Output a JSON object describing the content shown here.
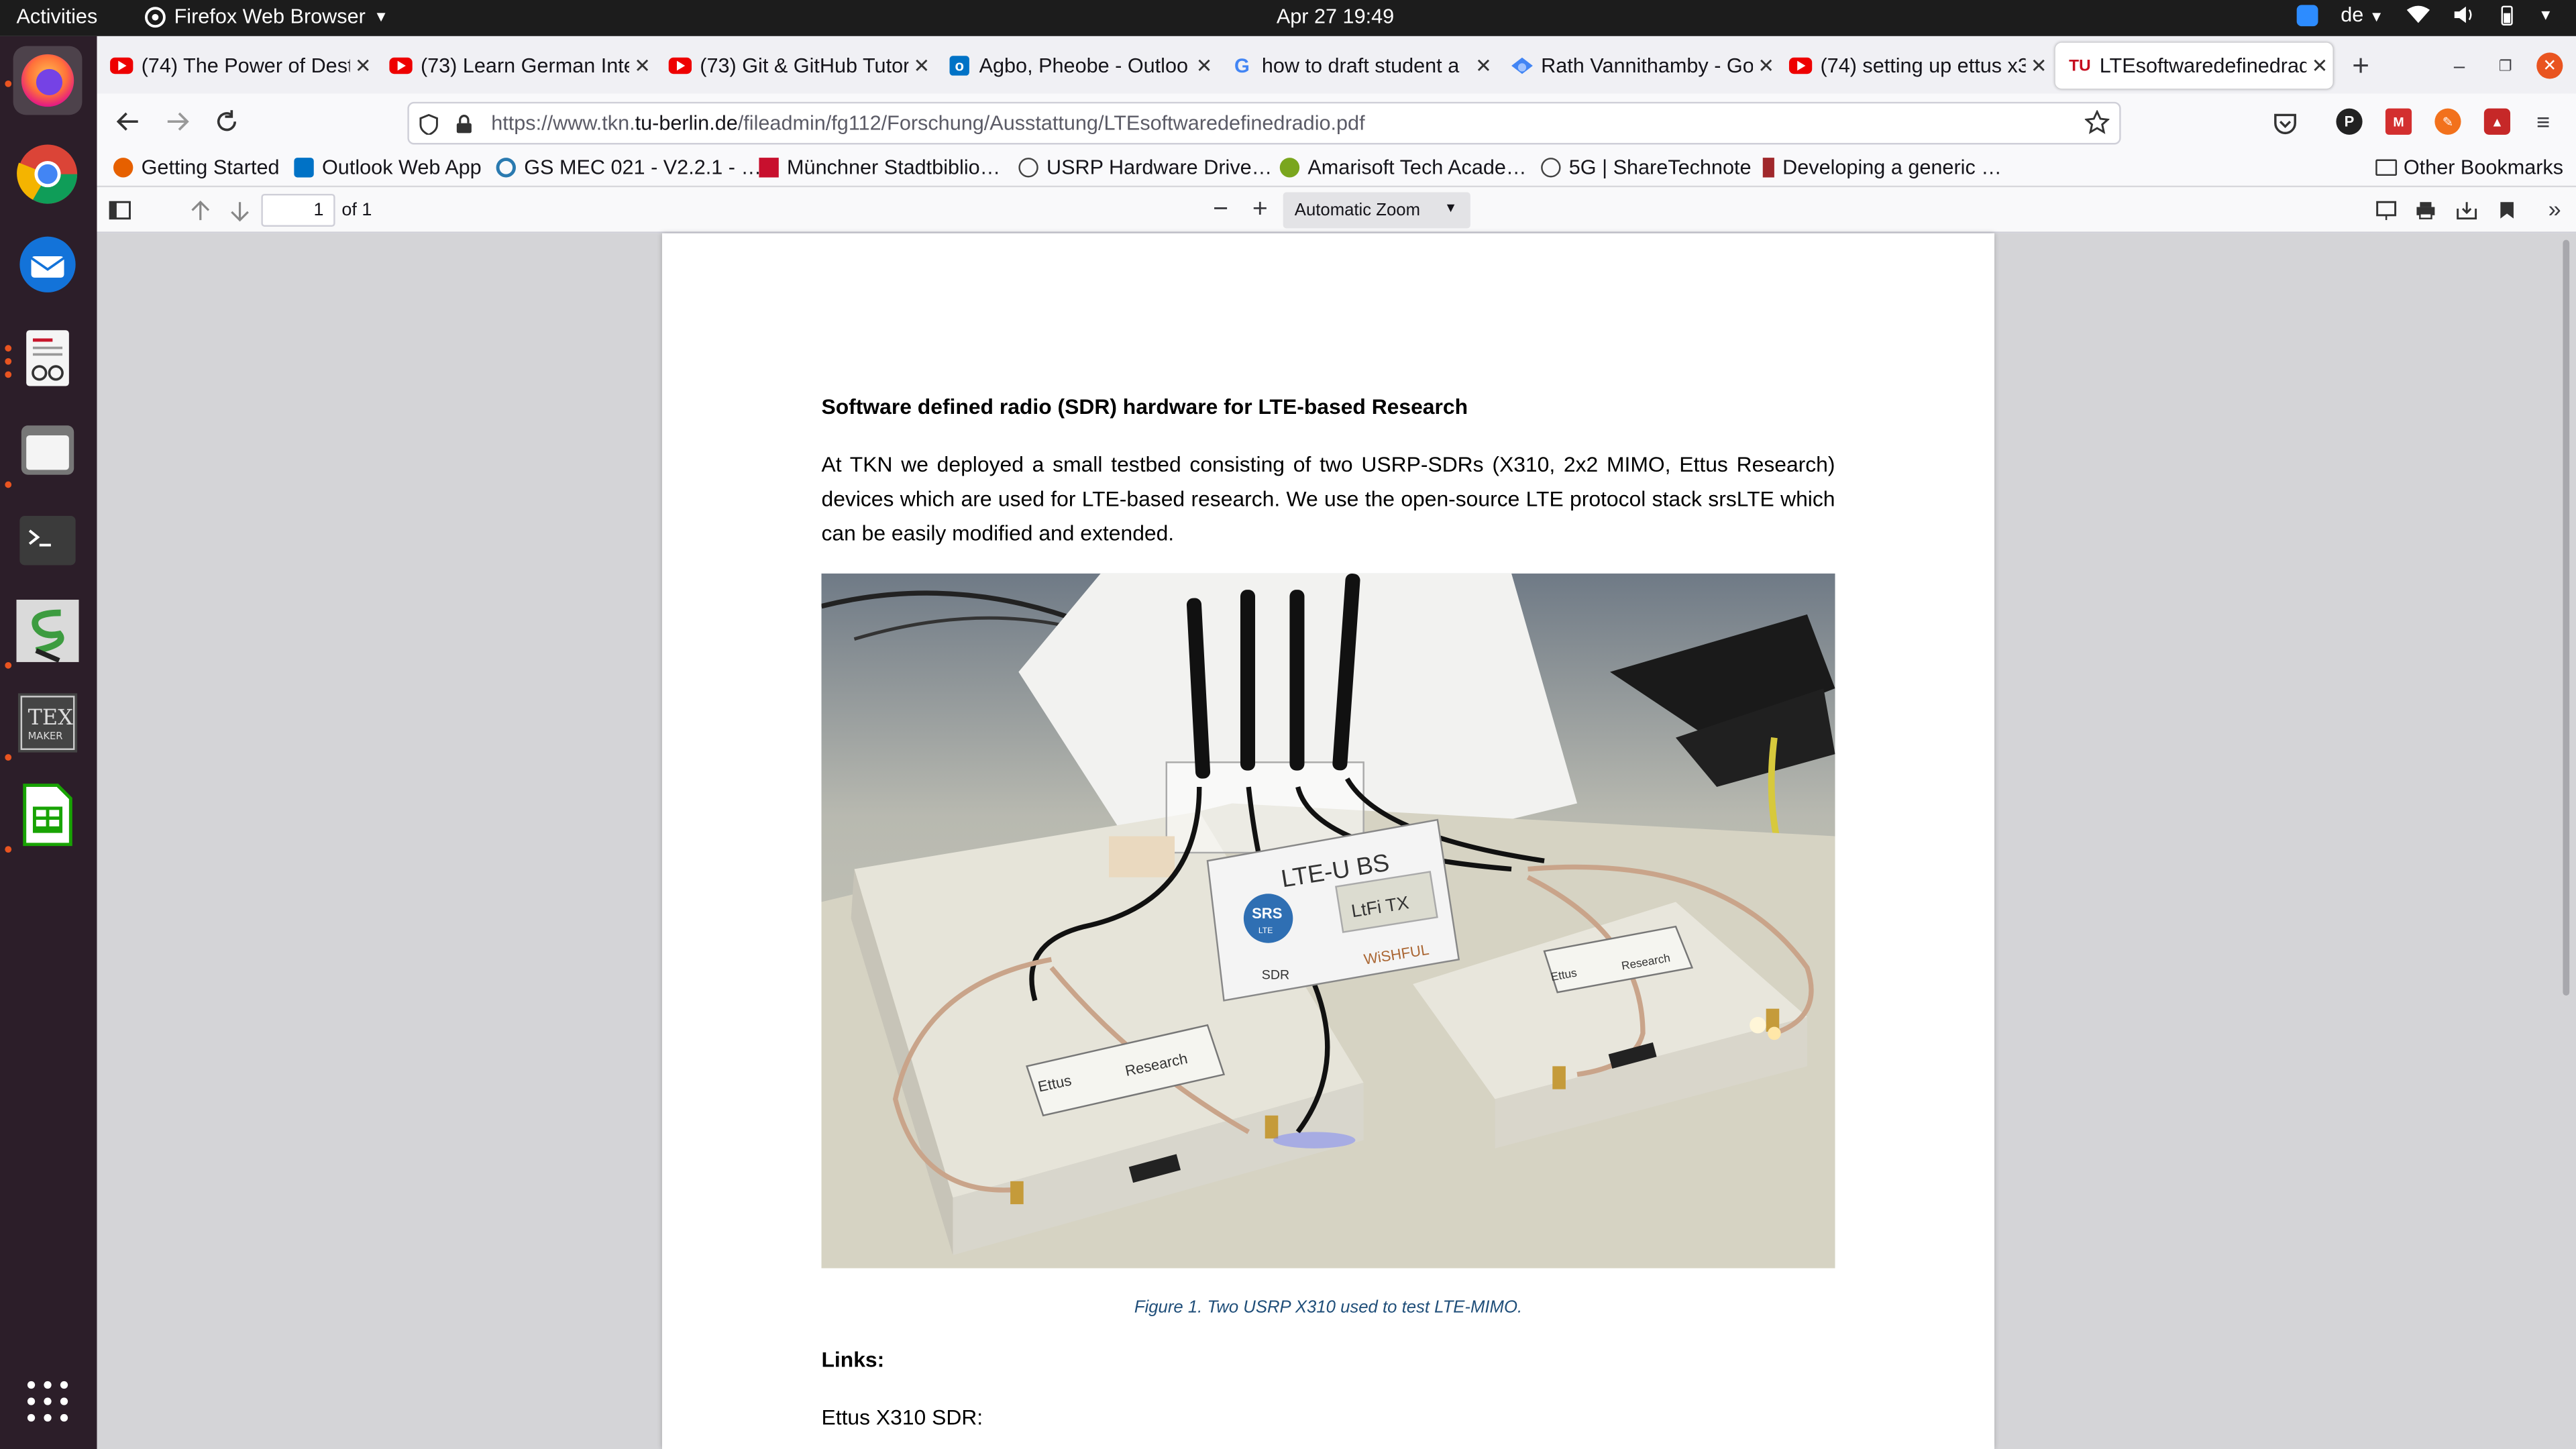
{
  "topbar": {
    "activities": "Activities",
    "app_name": "Firefox Web Browser",
    "clock": "Apr 27  19:49",
    "language": "de"
  },
  "tabs": [
    {
      "title": "(74) The Power of Dest",
      "icon": "youtube-icon"
    },
    {
      "title": "(73) Learn German Inte",
      "icon": "youtube-icon"
    },
    {
      "title": "(73) Git & GitHub Tutor",
      "icon": "youtube-icon"
    },
    {
      "title": "Agbo, Pheobe - Outloo",
      "icon": "outlook-icon"
    },
    {
      "title": "how to draft student a",
      "icon": "google-icon"
    },
    {
      "title": "Rath Vannithamby - Go",
      "icon": "scholar-icon"
    },
    {
      "title": "(74) setting up ettus x3",
      "icon": "youtube-icon"
    },
    {
      "title": "LTEsoftwaredefinedrad",
      "icon": "tu-berlin-icon"
    }
  ],
  "url": {
    "prefix": "https://www.tkn.",
    "domain": "tu-berlin.de",
    "path": "/fileadmin/fg112/Forschung/Ausstattung/LTEsoftwaredefinedradio.pdf"
  },
  "bookmarks": [
    {
      "label": "Getting Started",
      "color": "#e66000"
    },
    {
      "label": "Outlook Web App",
      "color": "#0072c6"
    },
    {
      "label": "GS MEC 021 - V2.2.1 - …",
      "color": "#2a7ab0"
    },
    {
      "label": "Münchner Stadtbiblio…",
      "color": "#c8102e"
    },
    {
      "label": "USRP Hardware Drive…",
      "color": "#444444"
    },
    {
      "label": "Amarisoft Tech Acade…",
      "color": "#7aa61e"
    },
    {
      "label": "5G | ShareTechnote",
      "color": "#444444"
    },
    {
      "label": "Developing a generic …",
      "color": "#a0282c"
    }
  ],
  "other_bookmarks": "Other Bookmarks",
  "pdf_toolbar": {
    "page_number": "1",
    "page_total": "of 1",
    "zoom": "Automatic Zoom"
  },
  "document": {
    "title": "Software defined radio (SDR) hardware for LTE-based Research",
    "paragraph": "At TKN we deployed a small testbed consisting of two USRP-SDRs (X310, 2x2 MIMO, Ettus Research) devices which are used for LTE-based research. We use the open-source LTE protocol stack srsLTE which can be easily modified and extended.",
    "caption": "Figure 1. Two USRP X310 used to test LTE-MIMO.",
    "links_heading": "Links:",
    "ettus_line": "Ettus X310 SDR:"
  },
  "photo_labels": {
    "sign_title": "LTE-U BS",
    "srs_top": "SRS",
    "srs_bottom": "LTE",
    "ltfi": "LtFi TX",
    "sdr": "SDR",
    "wishful": "WiSHFUL",
    "ettus_left": "Ettus",
    "research_left": "Research",
    "ettus_right": "Ettus",
    "research_right": "Research"
  },
  "colors": {
    "topbar": "#1c1c1c",
    "dock": "#2c1e29",
    "accent": "#e95420",
    "caption": "#1f4e79"
  }
}
